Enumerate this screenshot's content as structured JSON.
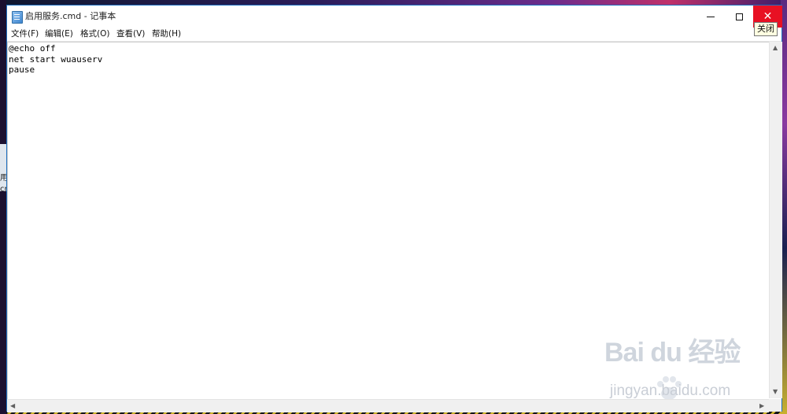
{
  "window": {
    "title": "启用服务.cmd - 记事本",
    "buttons": {
      "minimize_icon": "minimize-icon",
      "maximize_icon": "maximize-icon",
      "close_icon": "close-icon"
    },
    "close_tooltip": "关闭",
    "accent_color": "#e81123"
  },
  "menu": {
    "items": [
      {
        "label": "文件(F)"
      },
      {
        "label": "编辑(E)"
      },
      {
        "label": "格式(O)"
      },
      {
        "label": "查看(V)"
      },
      {
        "label": "帮助(H)"
      }
    ]
  },
  "editor": {
    "content": "@echo off\nnet start wuauserv\npause"
  },
  "desktop": {
    "icon_label": "用\ncr"
  },
  "watermark": {
    "brand": "Bai du 经验",
    "url": "jingyan.baidu.com"
  }
}
